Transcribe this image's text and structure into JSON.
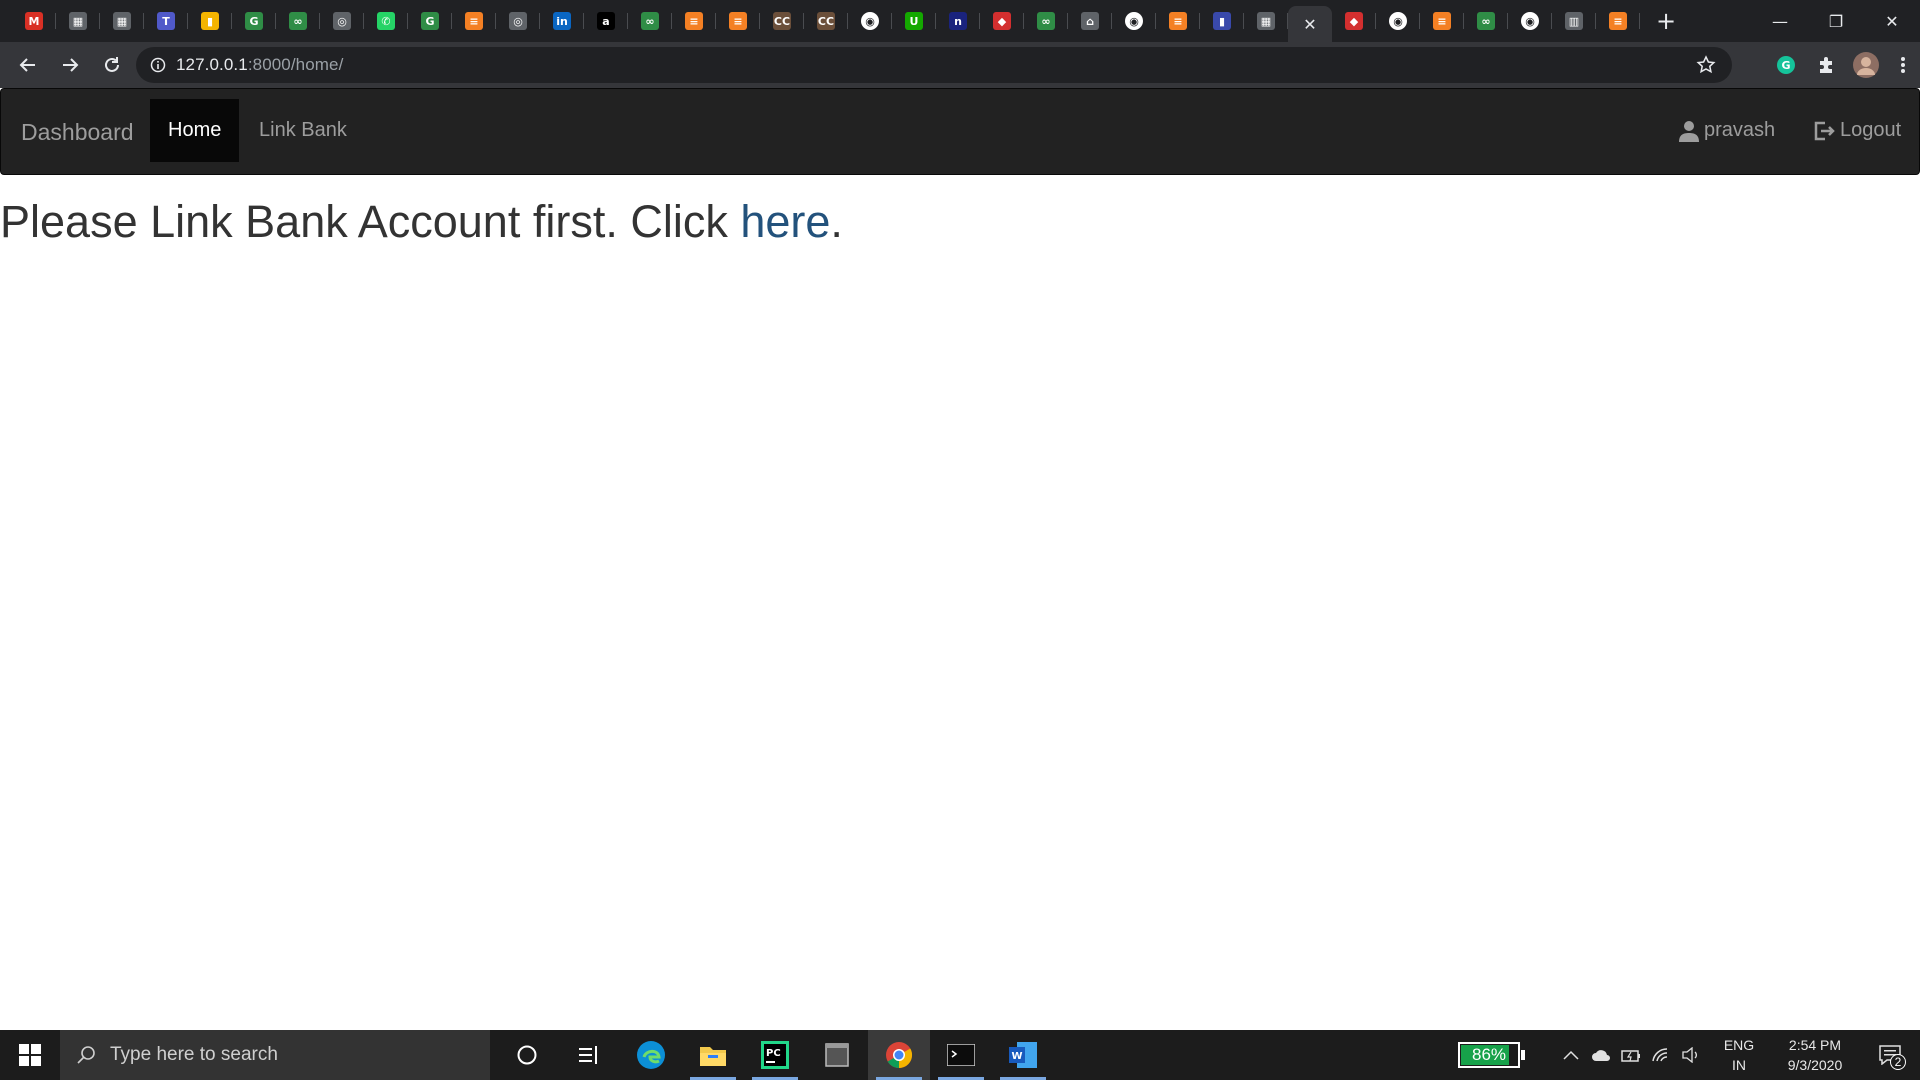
{
  "browser": {
    "tabs": [
      {
        "icon": "gmail-icon",
        "glyph": "M",
        "color": "#d93025"
      },
      {
        "icon": "app-icon",
        "glyph": "▦",
        "color": "#5f6368"
      },
      {
        "icon": "app-icon",
        "glyph": "▦",
        "color": "#5f6368"
      },
      {
        "icon": "teams-icon",
        "glyph": "T",
        "color": "#5059c9"
      },
      {
        "icon": "chart-icon",
        "glyph": "▮",
        "color": "#f4b400"
      },
      {
        "icon": "geeksforgeeks-icon",
        "glyph": "G",
        "color": "#2f8d46"
      },
      {
        "icon": "geeksforgeeks-icon",
        "glyph": "∞",
        "color": "#2f8d46"
      },
      {
        "icon": "circle-app-icon",
        "glyph": "◎",
        "color": "#5f6368"
      },
      {
        "icon": "whatsapp-icon",
        "glyph": "✆",
        "color": "#25d366"
      },
      {
        "icon": "geeksforgeeks-icon",
        "glyph": "G",
        "color": "#2f8d46"
      },
      {
        "icon": "stackoverflow-icon",
        "glyph": "≡",
        "color": "#f48024"
      },
      {
        "icon": "circle-app-icon",
        "glyph": "◎",
        "color": "#5f6368"
      },
      {
        "icon": "linkedin-icon",
        "glyph": "in",
        "color": "#0a66c2"
      },
      {
        "icon": "amazon-icon",
        "glyph": "a",
        "color": "#000000"
      },
      {
        "icon": "geeksforgeeks-icon",
        "glyph": "∞",
        "color": "#2f8d46"
      },
      {
        "icon": "stackoverflow-icon",
        "glyph": "≡",
        "color": "#f48024"
      },
      {
        "icon": "stackoverflow-icon",
        "glyph": "≡",
        "color": "#f48024"
      },
      {
        "icon": "cc-icon",
        "glyph": "CC",
        "color": "#6b4f3a"
      },
      {
        "icon": "cc-icon",
        "glyph": "CC",
        "color": "#6b4f3a"
      },
      {
        "icon": "github-icon",
        "glyph": "◉",
        "color": "#ffffff"
      },
      {
        "icon": "upwork-icon",
        "glyph": "U",
        "color": "#14a800"
      },
      {
        "icon": "n-app-icon",
        "glyph": "n",
        "color": "#1a237e"
      },
      {
        "icon": "red-app-icon",
        "glyph": "◆",
        "color": "#d32f2f"
      },
      {
        "icon": "geeksforgeeks-icon",
        "glyph": "∞",
        "color": "#2f8d46"
      },
      {
        "icon": "app-icon",
        "glyph": "⌂",
        "color": "#5f6368"
      },
      {
        "icon": "github-icon",
        "glyph": "◉",
        "color": "#ffffff"
      },
      {
        "icon": "stackoverflow-icon",
        "glyph": "≡",
        "color": "#f48024"
      },
      {
        "icon": "purple-app-icon",
        "glyph": "▮",
        "color": "#3949ab"
      },
      {
        "icon": "app-icon",
        "glyph": "▦",
        "color": "#5f6368"
      },
      {
        "icon": "active-tab-close-icon",
        "glyph": "✕",
        "color": "#35363a"
      },
      {
        "icon": "red-app-icon",
        "glyph": "◆",
        "color": "#d32f2f"
      },
      {
        "icon": "github-icon",
        "glyph": "◉",
        "color": "#ffffff"
      },
      {
        "icon": "stackoverflow-icon",
        "glyph": "≡",
        "color": "#f48024"
      },
      {
        "icon": "geeksforgeeks-icon",
        "glyph": "∞",
        "color": "#2f8d46"
      },
      {
        "icon": "github-icon",
        "glyph": "◉",
        "color": "#ffffff"
      },
      {
        "icon": "book-icon",
        "glyph": "▥",
        "color": "#5f6368"
      },
      {
        "icon": "stackoverflow-icon",
        "glyph": "≡",
        "color": "#f48024"
      }
    ],
    "url_host": "127.0.0.1",
    "url_rest": ":8000/home/"
  },
  "site": {
    "brand": "Dashboard",
    "nav": {
      "home": "Home",
      "link_bank": "Link Bank",
      "user": "pravash",
      "logout": "Logout"
    },
    "message": {
      "text": "Please Link Bank Account first. Click ",
      "link": "here",
      "suffix": "."
    }
  },
  "taskbar": {
    "search_placeholder": "Type here to search",
    "battery_percent": "86%",
    "battery_level": 0.86,
    "lang_1": "ENG",
    "lang_2": "IN",
    "time": "2:54 PM",
    "date": "9/3/2020",
    "notification_count": "2"
  }
}
